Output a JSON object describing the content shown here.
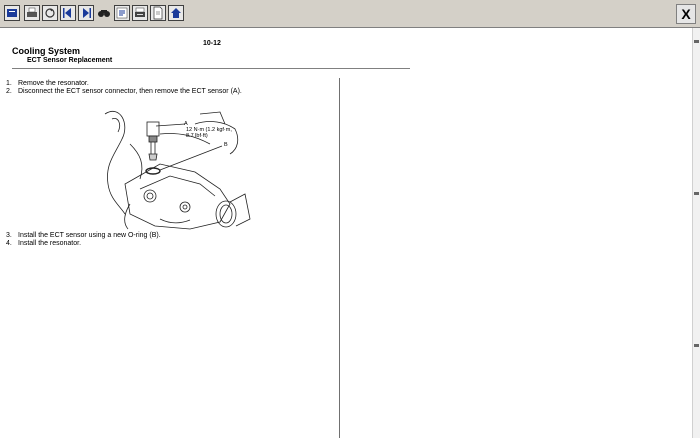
{
  "toolbar": {
    "buttons": [
      {
        "name": "print-icon"
      },
      {
        "name": "print-setup-icon"
      },
      {
        "name": "open-icon"
      },
      {
        "name": "back-icon"
      },
      {
        "name": "forward-icon"
      },
      {
        "name": "find-icon"
      },
      {
        "name": "bookmark-icon"
      },
      {
        "name": "print-page-icon"
      },
      {
        "name": "document-icon"
      },
      {
        "name": "home-icon"
      }
    ],
    "close_label": "X"
  },
  "page": {
    "page_number": "10-12",
    "section_title": "Cooling System",
    "subsection_title": "ECT Sensor Replacement",
    "steps_top": [
      {
        "num": "1.",
        "text": "Remove the resonator."
      },
      {
        "num": "2.",
        "text": "Disconnect the ECT sensor connector, then remove the ECT sensor (A)."
      }
    ],
    "steps_bottom": [
      {
        "num": "3.",
        "text": "Install the ECT sensor using a new O-ring (B)."
      },
      {
        "num": "4.",
        "text": "Install the resonator."
      }
    ],
    "figure_labels": {
      "a_label": "A",
      "torque_line1": "12 N·m (1.2 kgf·m,",
      "torque_line2": "8.7 lbf·ft)",
      "b_label": "B"
    }
  }
}
